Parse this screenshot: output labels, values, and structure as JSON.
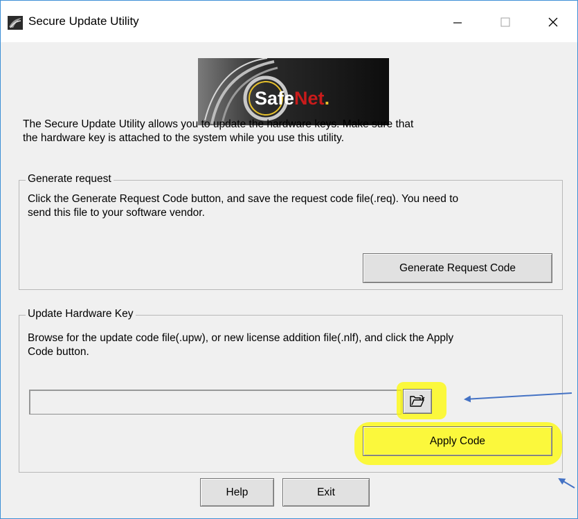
{
  "window": {
    "title": "Secure Update Utility",
    "accent_color": "#3c8fd6",
    "controls": {
      "minimize": "minimize-icon",
      "maximize": "maximize-icon",
      "close": "close-icon"
    }
  },
  "logo": {
    "text_left": "Safe",
    "text_right": "Net",
    "dot": "."
  },
  "intro": {
    "line1": "The Secure Update Utility allows you to update the hardware keys. Make sure that",
    "line2": "the hardware key is attached to the system while you use this utility."
  },
  "generate_group": {
    "legend": "Generate request",
    "line1": "Click the Generate Request Code button, and save the request code file(.req). You need to",
    "line2": "send this file to your software vendor.",
    "button_label": "Generate Request Code"
  },
  "update_group": {
    "legend": "Update Hardware Key",
    "line1": "Browse for the update code file(.upw), or new license addition file(.nlf), and click the Apply",
    "line2": "Code button.",
    "file_path_value": "",
    "browse_icon": "open-folder-icon",
    "apply_label": "Apply Code",
    "highlight_color": "#fffb00",
    "annotation_arrow_color": "#4472c4"
  },
  "footer": {
    "help_label": "Help",
    "exit_label": "Exit"
  }
}
